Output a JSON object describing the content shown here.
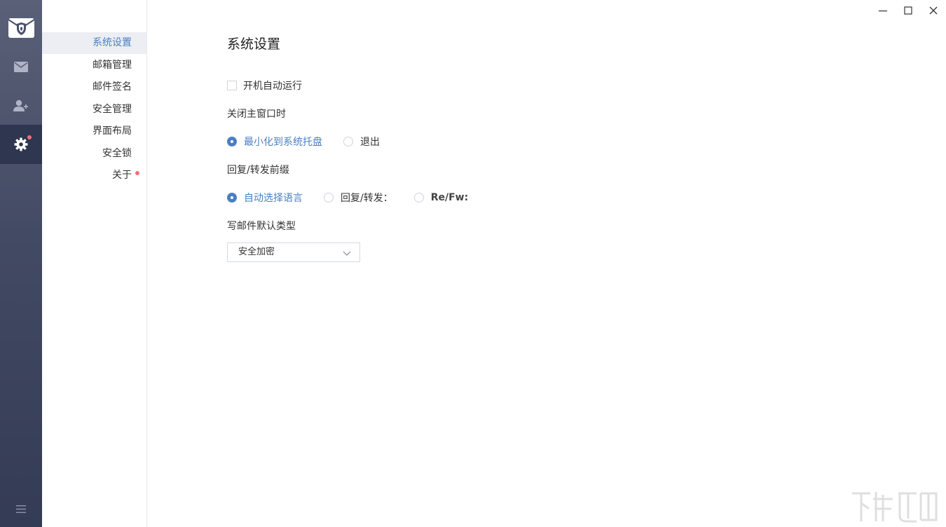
{
  "window": {
    "minimize_icon": "minimize-icon",
    "maximize_icon": "maximize-icon",
    "close_icon": "close-icon"
  },
  "rail": {
    "items": [
      {
        "name": "logo",
        "icon": "shield-envelope-icon"
      },
      {
        "name": "mail",
        "icon": "envelope-icon"
      },
      {
        "name": "contacts",
        "icon": "add-contact-icon"
      },
      {
        "name": "settings",
        "icon": "gear-icon",
        "active": true,
        "badge": true
      }
    ],
    "menu_icon": "hamburger-menu-icon"
  },
  "subnav": {
    "items": [
      {
        "label": "系统设置",
        "active": true
      },
      {
        "label": "邮箱管理"
      },
      {
        "label": "邮件签名"
      },
      {
        "label": "安全管理"
      },
      {
        "label": "界面布局"
      },
      {
        "label": "安全锁"
      },
      {
        "label": "关于",
        "badge": true
      }
    ]
  },
  "main": {
    "title": "系统设置",
    "autostart": {
      "label": "开机自动运行",
      "checked": false
    },
    "close_window": {
      "label": "关闭主窗口时",
      "options": [
        {
          "label": "最小化到系统托盘",
          "selected": true
        },
        {
          "label": "退出",
          "selected": false
        }
      ]
    },
    "reply_prefix": {
      "label": "回复/转发前缀",
      "options": [
        {
          "label": "自动选择语言",
          "selected": true
        },
        {
          "label": "回复/转发：",
          "selected": false
        },
        {
          "label": "Re/Fw:",
          "selected": false
        }
      ]
    },
    "default_type": {
      "label": "写邮件默认类型",
      "value": "安全加密"
    }
  },
  "colors": {
    "accent": "#4a7fc1",
    "badge": "#f07079",
    "rail_top": "#5a6077",
    "rail_bottom": "#343b55"
  }
}
